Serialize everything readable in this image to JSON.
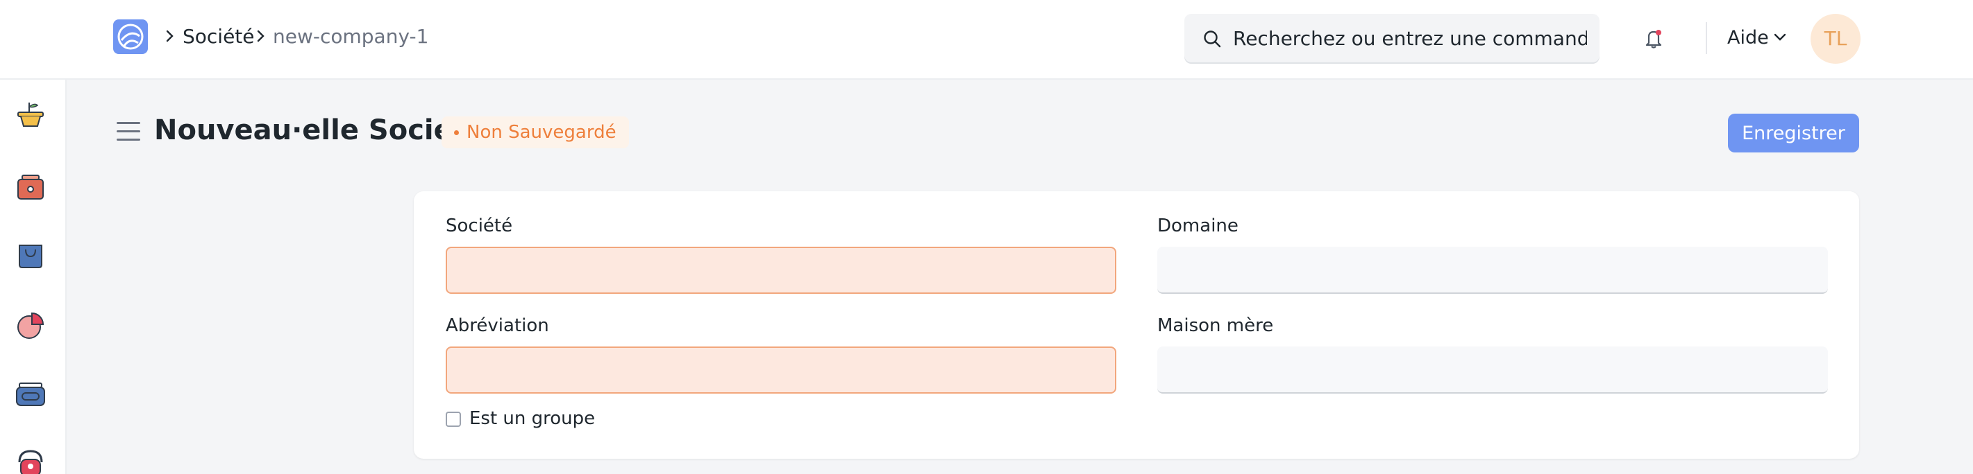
{
  "breadcrumb": {
    "items": [
      "Société",
      "new-company-1"
    ]
  },
  "search": {
    "placeholder": "Recherchez ou entrez une commande"
  },
  "navbar": {
    "help_label": "Aide",
    "avatar_initials": "TL"
  },
  "page": {
    "title": "Nouveau·elle Société",
    "status_badge": "Non Sauvegardé",
    "save_label": "Enregistrer"
  },
  "form": {
    "company_label": "Société",
    "company_value": "",
    "abbreviation_label": "Abréviation",
    "abbreviation_value": "",
    "domain_label": "Domaine",
    "domain_value": "",
    "parent_label": "Maison mère",
    "parent_value": "",
    "is_group_label": "Est un groupe",
    "is_group_checked": false
  },
  "sidebar": {
    "icons": [
      "basket-plant-icon",
      "safe-icon",
      "shopping-bag-icon",
      "pie-chart-icon",
      "wallet-icon",
      "support-icon"
    ]
  },
  "colors": {
    "accent": "#6f95f2",
    "required_fill": "#fde8df",
    "required_border": "#f2a67c",
    "status_orange": "#ee7f3b"
  }
}
